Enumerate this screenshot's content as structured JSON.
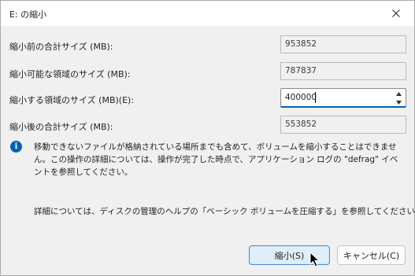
{
  "window": {
    "title": "E: の縮小",
    "close_icon": "close-icon"
  },
  "rows": {
    "total_before": {
      "label": "縮小前の合計サイズ (MB):",
      "value": "953852"
    },
    "available": {
      "label": "縮小可能な領域のサイズ (MB):",
      "value": "787837"
    },
    "shrink_amount": {
      "label": "縮小する領域のサイズ (MB)(E):",
      "value": "400000"
    },
    "total_after": {
      "label": "縮小後の合計サイズ (MB):",
      "value": "553852"
    }
  },
  "info": {
    "icon": "info-icon",
    "message": "移動できないファイルが格納されている場所までも含めて、ボリュームを縮小することはできません。この操作の詳細については、操作が完了した時点で、アプリケーション ログの \"defrag\" イベントを参照してください。",
    "help": "詳細については、ディスクの管理のヘルプの「ベーシック ボリュームを圧縮する」を参照してください"
  },
  "buttons": {
    "shrink": "縮小(S)",
    "cancel": "キャンセル(C)"
  },
  "colors": {
    "accent": "#005fb8",
    "primary_button_bg": "#e0eef9",
    "primary_button_border": "#4a8fd0"
  }
}
